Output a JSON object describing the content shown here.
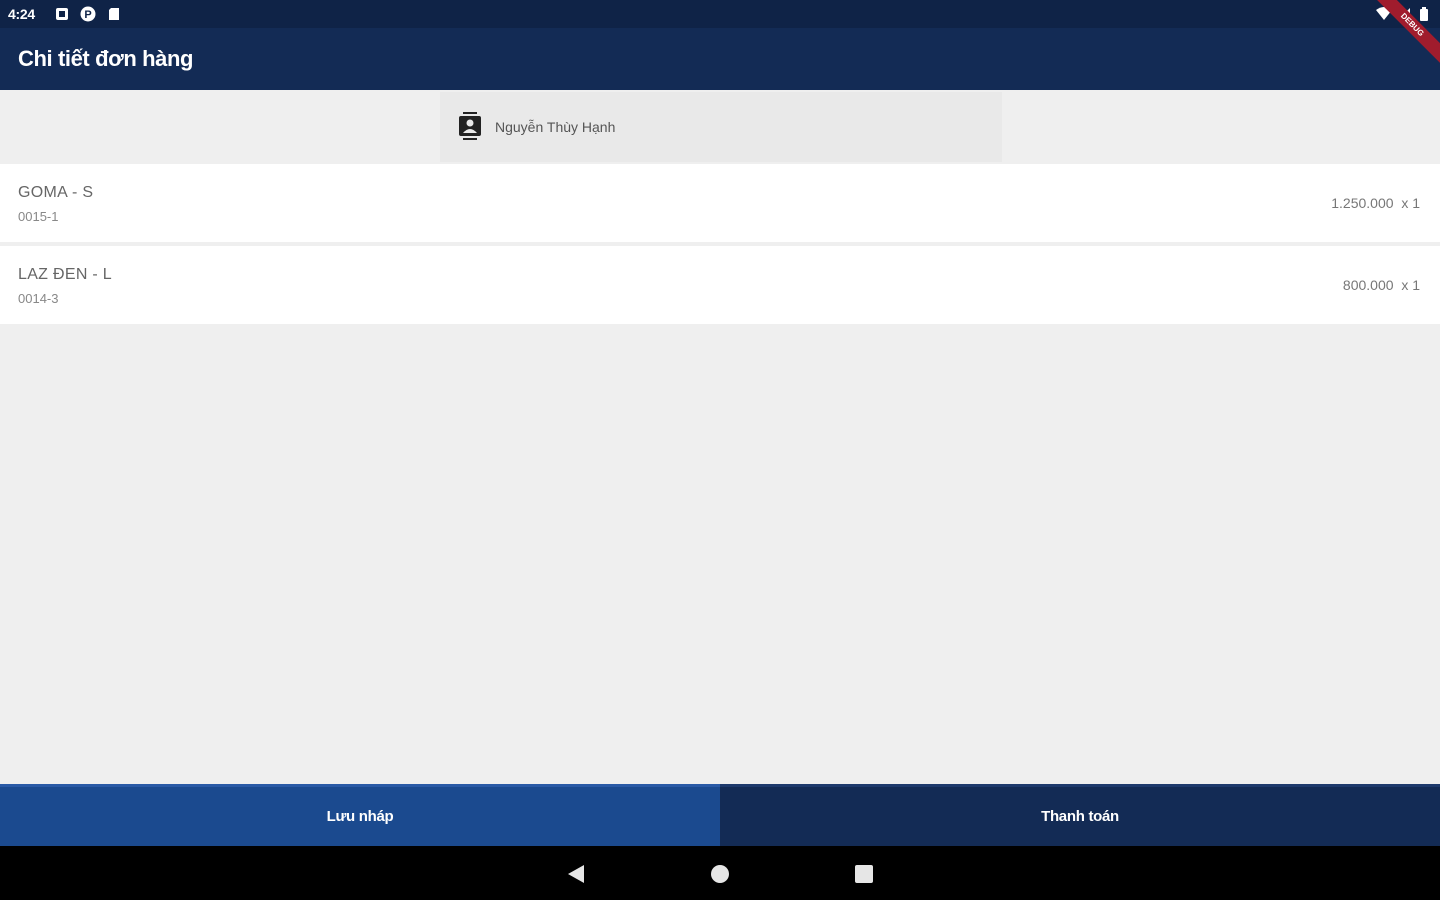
{
  "status_bar": {
    "time": "4:24",
    "left_icons": [
      "notification-box-icon",
      "p-badge-icon",
      "sd-card-icon"
    ],
    "right_icons": [
      "wifi-icon",
      "signal-icon",
      "battery-icon"
    ]
  },
  "app_bar": {
    "title": "Chi tiết đơn hàng",
    "debug_banner": "DEBUG"
  },
  "customer": {
    "icon": "contact-card-icon",
    "name": "Nguyễn Thùy Hạnh"
  },
  "items": [
    {
      "name": "GOMA - S",
      "code": "0015-1",
      "price": "1.250.000",
      "qty": "x 1"
    },
    {
      "name": "LAZ ĐEN - L",
      "code": "0014-3",
      "price": "800.000",
      "qty": "x 1"
    }
  ],
  "actions": {
    "draft_label": "Lưu nháp",
    "pay_label": "Thanh toán"
  },
  "nav_bar": {
    "icons": [
      "back-icon",
      "home-icon",
      "recents-icon"
    ]
  },
  "colors": {
    "status_bar": "#0f2347",
    "app_bar": "#132b55",
    "draft_button": "#1b4a8f",
    "pay_button": "#132b55",
    "background": "#efefef"
  }
}
